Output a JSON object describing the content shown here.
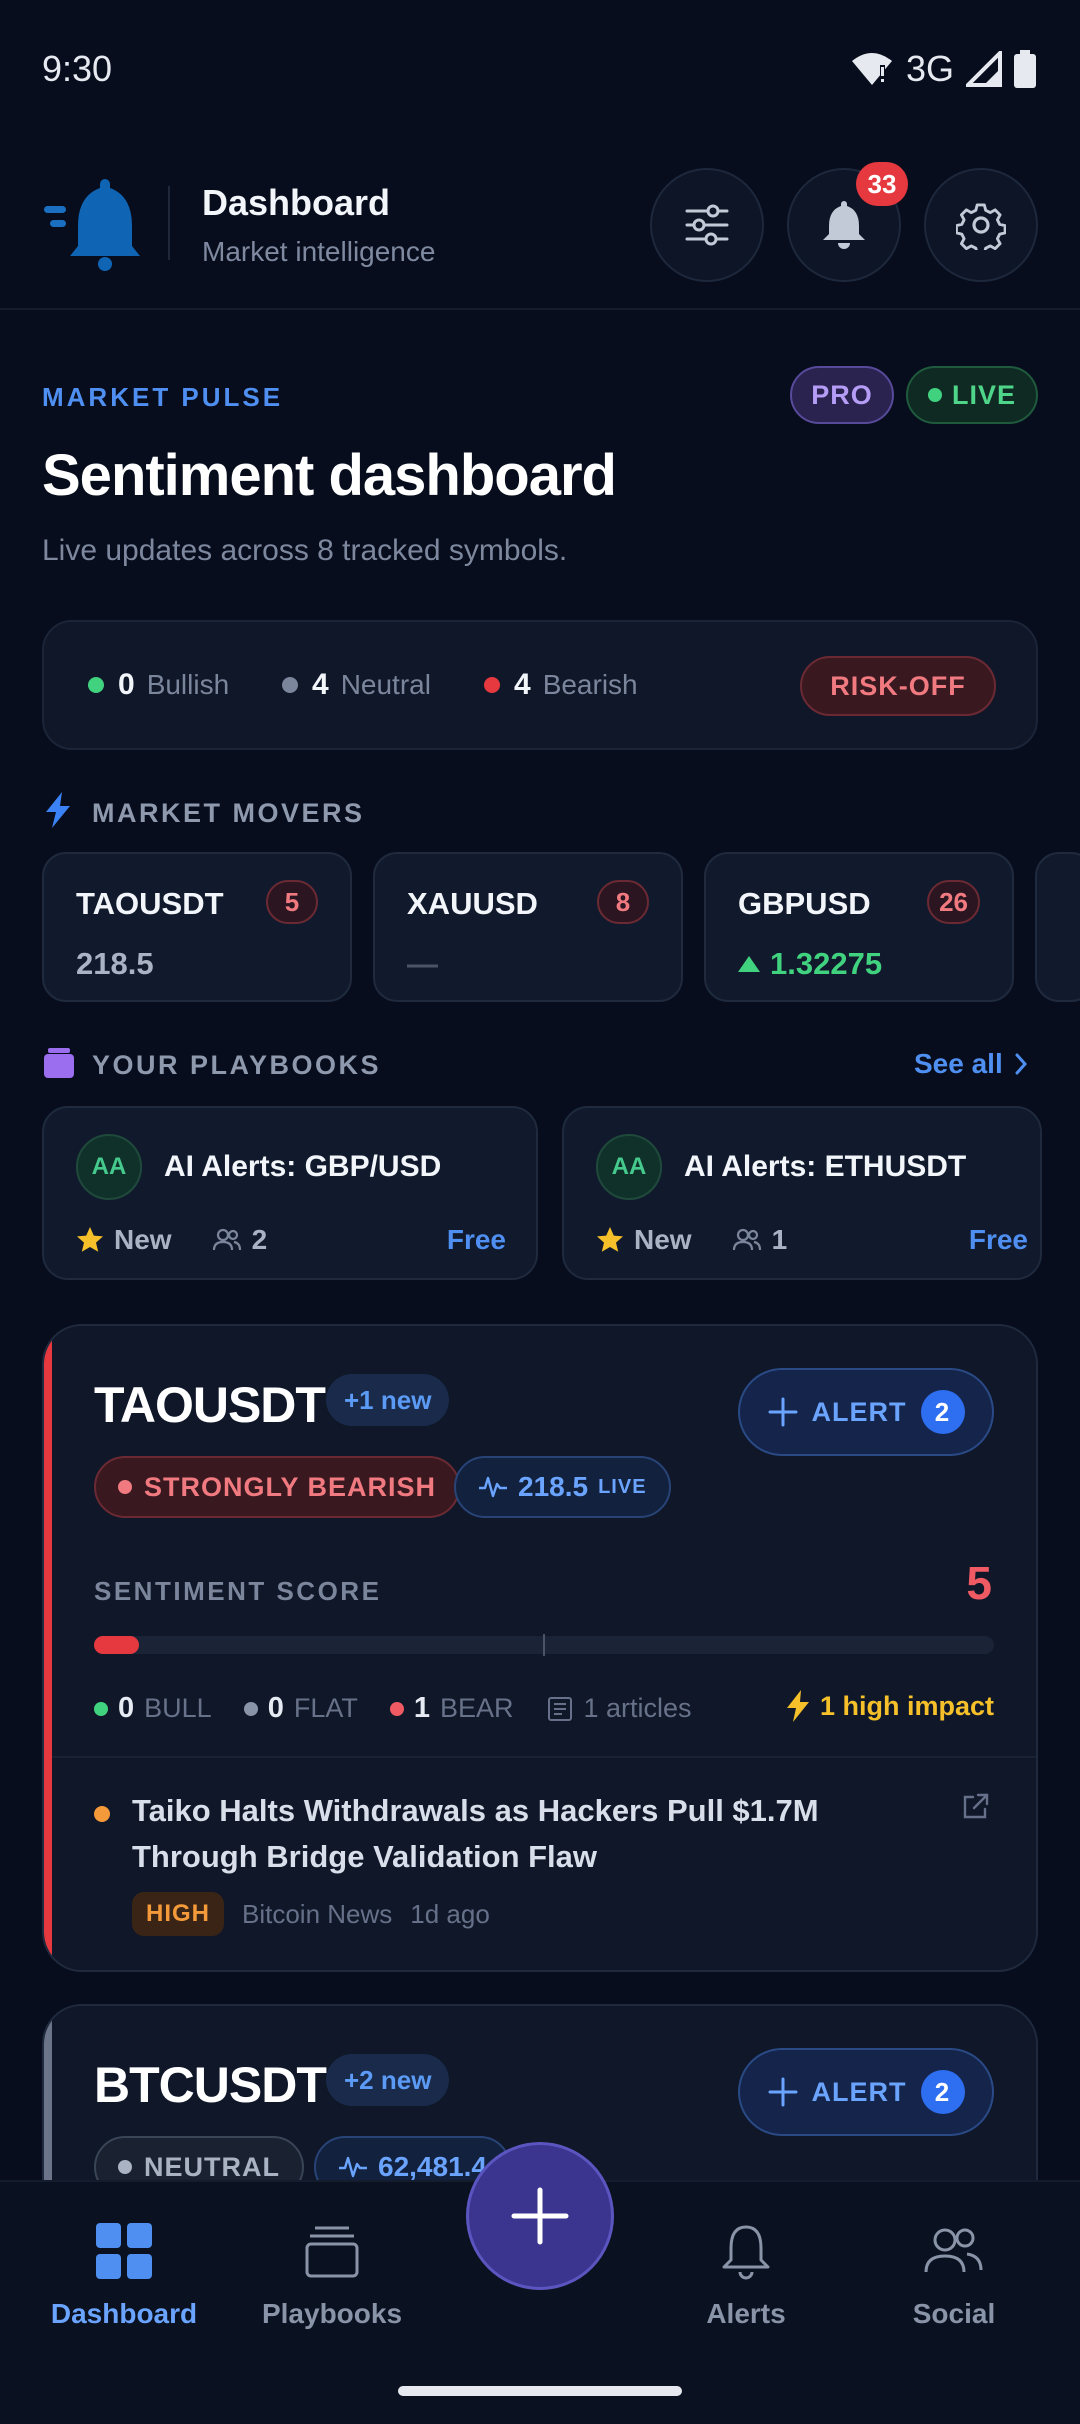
{
  "status": {
    "time": "9:30",
    "network": "3G"
  },
  "header": {
    "title": "Dashboard",
    "subtitle": "Market intelligence",
    "notif_count": "33"
  },
  "pulse": {
    "eyebrow": "MARKET PULSE",
    "pro": "PRO",
    "live": "LIVE",
    "title": "Sentiment dashboard",
    "subtitle": "Live updates across 8 tracked symbols.",
    "bullish_count": "0",
    "bullish_label": "Bullish",
    "neutral_count": "4",
    "neutral_label": "Neutral",
    "bearish_count": "4",
    "bearish_label": "Bearish",
    "risk": "RISK-OFF"
  },
  "movers": {
    "label": "MARKET MOVERS",
    "items": [
      {
        "symbol": "TAOUSDT",
        "count": "5",
        "value": "218.5"
      },
      {
        "symbol": "XAUUSD",
        "count": "8",
        "value": "—"
      },
      {
        "symbol": "GBPUSD",
        "count": "26",
        "value": "1.32275"
      }
    ]
  },
  "playbooks": {
    "label": "YOUR PLAYBOOKS",
    "see_all": "See all",
    "items": [
      {
        "avatar": "AA",
        "title": "AI Alerts: GBP/USD",
        "status": "New",
        "members": "2",
        "price": "Free"
      },
      {
        "avatar": "AA",
        "title": "AI Alerts: ETHUSDT",
        "status": "New",
        "members": "1",
        "price": "Free"
      }
    ]
  },
  "cards": [
    {
      "symbol": "TAOUSDT",
      "new": "+1 new",
      "alert_label": "ALERT",
      "alert_count": "2",
      "sentiment": "STRONGLY BEARISH",
      "price": "218.5",
      "price_live": "LIVE",
      "score_label": "SENTIMENT SCORE",
      "score": "5",
      "score_fill": 0.05,
      "bull": "0",
      "bull_label": "BULL",
      "flat": "0",
      "flat_label": "FLAT",
      "bear": "1",
      "bear_label": "BEAR",
      "articles": "1 articles",
      "impact": "1 high impact",
      "news_title": "Taiko Halts Withdrawals as Hackers Pull $1.7M Through Bridge Validation Flaw",
      "news_tag": "HIGH",
      "news_source": "Bitcoin News",
      "news_time": "1d ago"
    },
    {
      "symbol": "BTCUSDT",
      "new": "+2 new",
      "alert_label": "ALERT",
      "alert_count": "2",
      "sentiment": "NEUTRAL",
      "price": "62,481.4"
    }
  ],
  "nav": {
    "dashboard": "Dashboard",
    "playbooks": "Playbooks",
    "alerts": "Alerts",
    "social": "Social"
  },
  "colors": {
    "accent": "#4f8ff2",
    "bearish": "#e5393f",
    "bullish": "#41d27f",
    "impact": "#f5c02a"
  }
}
